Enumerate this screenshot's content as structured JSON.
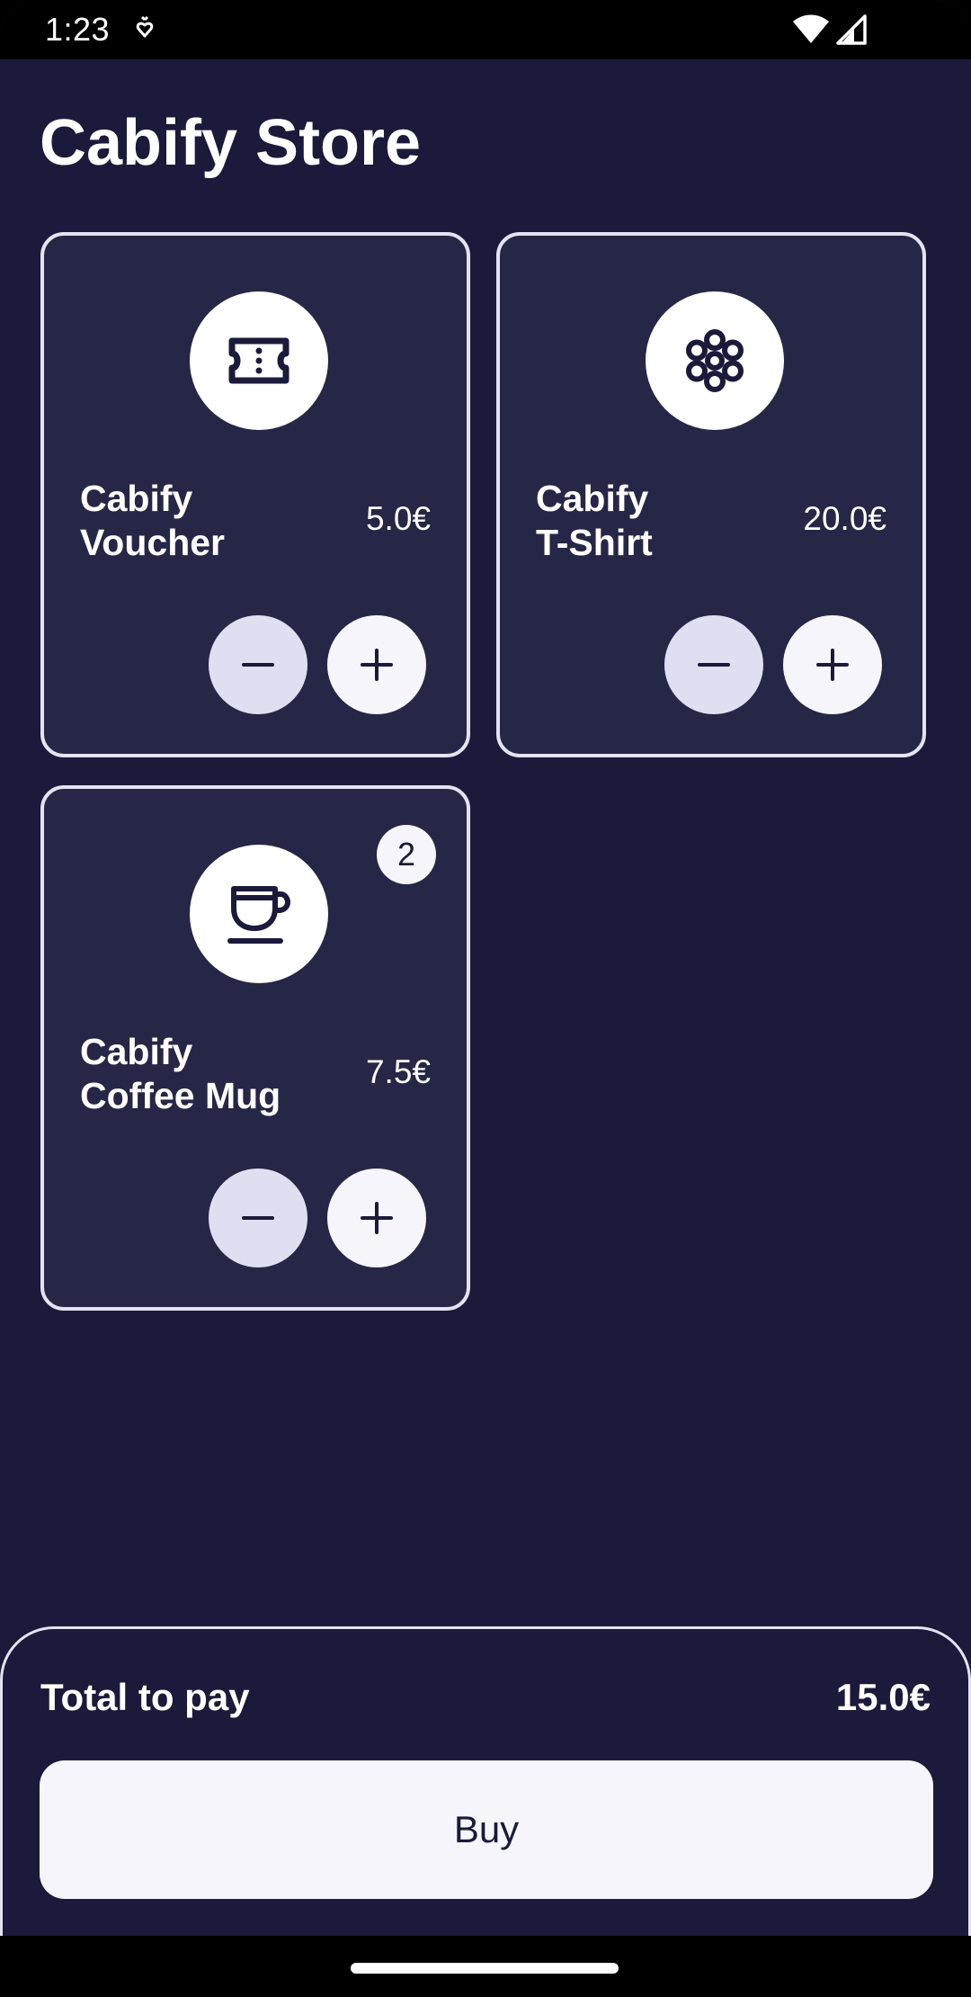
{
  "status_bar": {
    "time": "1:23",
    "icons": [
      "heart-icon",
      "wifi-icon",
      "signal-icon"
    ]
  },
  "page": {
    "title": "Cabify Store"
  },
  "products": [
    {
      "name": "Cabify\nVoucher",
      "price": "5.0€",
      "icon": "ticket-icon",
      "count": null
    },
    {
      "name": "Cabify\nT-Shirt",
      "price": "20.0€",
      "icon": "flower-icon",
      "count": null
    },
    {
      "name": "Cabify\nCoffee Mug",
      "price": "7.5€",
      "icon": "coffee-cup-icon",
      "count": "2"
    }
  ],
  "checkout": {
    "total_label": "Total to pay",
    "total_value": "15.0€",
    "buy_label": "Buy"
  },
  "colors": {
    "background": "#1b1a3a",
    "card": "#262646",
    "border": "#e3e3f2",
    "minus_button": "#dfdff2",
    "plus_button": "#f6f5fb"
  }
}
